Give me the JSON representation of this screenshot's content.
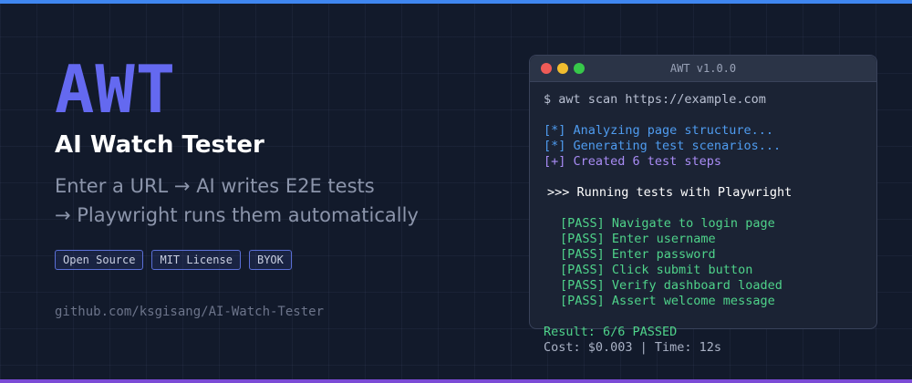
{
  "hero": {
    "logo": "AWT",
    "title": "AI Watch Tester",
    "tagline_line1": "Enter a URL → AI writes E2E tests",
    "tagline_line2": "→ Playwright runs them automatically",
    "badges": [
      "Open Source",
      "MIT License",
      "BYOK"
    ],
    "repo": "github.com/ksgisang/AI-Watch-Tester"
  },
  "terminal": {
    "title": "AWT v1.0.0",
    "command": "$ awt scan https://example.com",
    "steps": [
      "[*] Analyzing page structure...",
      "[*] Generating test scenarios...",
      "[+] Created 6 test steps"
    ],
    "running": ">>> Running tests with Playwright",
    "results": [
      "[PASS] Navigate to login page",
      "[PASS] Enter username",
      "[PASS] Enter password",
      "[PASS] Click submit button",
      "[PASS] Verify dashboard loaded",
      "[PASS] Assert welcome message"
    ],
    "summary": "Result: 6/6 PASSED",
    "cost": "Cost: $0.003 | Time: 12s"
  },
  "colors": {
    "background": "#121a2b",
    "logo": "#6469f0",
    "accent_top": "#3f86f0",
    "accent_bottom": "#7b4bd6",
    "pass": "#4fd38a",
    "info": "#4f9cf0",
    "created": "#a98cf5"
  }
}
